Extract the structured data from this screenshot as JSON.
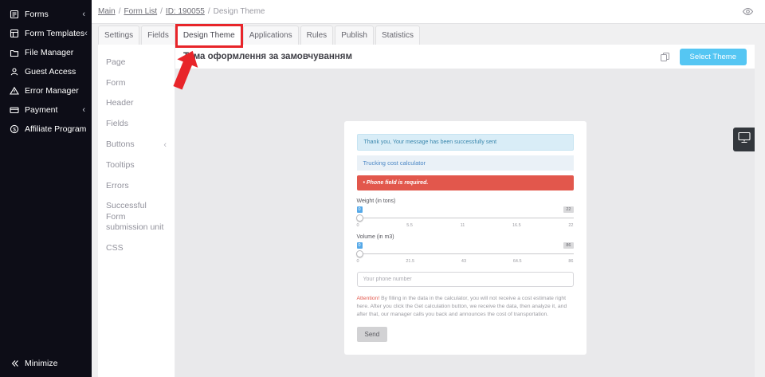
{
  "colors": {
    "accent_blue": "#55c6f3",
    "error_red": "#e2574c",
    "annotation_red": "#e8252a",
    "sidebar_bg": "#0d0d17",
    "success_info_bg": "#d9edf7"
  },
  "sidebar": {
    "items": [
      {
        "label": "Forms",
        "icon": "forms-icon",
        "has_chevron": true
      },
      {
        "label": "Form Templates",
        "icon": "form-templates-icon",
        "has_chevron": true
      },
      {
        "label": "File Manager",
        "icon": "file-manager-icon",
        "has_chevron": false
      },
      {
        "label": "Guest Access",
        "icon": "guest-access-icon",
        "has_chevron": false
      },
      {
        "label": "Error Manager",
        "icon": "error-manager-icon",
        "has_chevron": false
      },
      {
        "label": "Payment",
        "icon": "payment-icon",
        "has_chevron": true
      },
      {
        "label": "Affiliate Program",
        "icon": "affiliate-program-icon",
        "has_chevron": false
      }
    ],
    "minimize": {
      "label": "Minimize",
      "icon": "minimize-icon"
    }
  },
  "breadcrumb": {
    "separator": "/",
    "items": [
      "Main",
      "Form List",
      "ID: 190055",
      "Design Theme"
    ]
  },
  "tabs": [
    {
      "label": "Settings",
      "active": false
    },
    {
      "label": "Fields",
      "active": false
    },
    {
      "label": "Design Theme",
      "active": true
    },
    {
      "label": "Applications",
      "active": false
    },
    {
      "label": "Rules",
      "active": false
    },
    {
      "label": "Publish",
      "active": false
    },
    {
      "label": "Statistics",
      "active": false
    }
  ],
  "design_panel": {
    "items": [
      {
        "label": "Page"
      },
      {
        "label": "Form"
      },
      {
        "label": "Header"
      },
      {
        "label": "Fields"
      },
      {
        "label": "Buttons",
        "has_chevron": true
      },
      {
        "label": "Tooltips"
      },
      {
        "label": "Errors"
      },
      {
        "label": "Successful Form submission unit"
      },
      {
        "label": "CSS"
      }
    ]
  },
  "content_header": {
    "title": "Тема оформлення за замовчуванням",
    "select_theme_button": "Select Theme"
  },
  "form_preview": {
    "success_message": "Thank you, Your message has been successfully sent",
    "form_title": "Trucking cost calculator",
    "error_message": "•  Phone field is required.",
    "sliders": [
      {
        "label": "Weight (in tons)",
        "value_badge": "0",
        "max_badge": "22",
        "scale": [
          "0",
          "5.5",
          "11",
          "16.5",
          "22"
        ]
      },
      {
        "label": "Volume (in m3)",
        "value_badge": "0",
        "max_badge": "86",
        "scale": [
          "0",
          "21.5",
          "43",
          "64.5",
          "86"
        ]
      }
    ],
    "phone_placeholder": "Your phone number",
    "attention_prefix": "Attention!",
    "attention_body": " By filling in the data in the calculator, you will not receive a cost estimate right here. After you click the Get calculation button, we receive the data, then analyze it, and after that, our manager calls you back and announces the cost of transportation.",
    "send_button": "Send"
  }
}
